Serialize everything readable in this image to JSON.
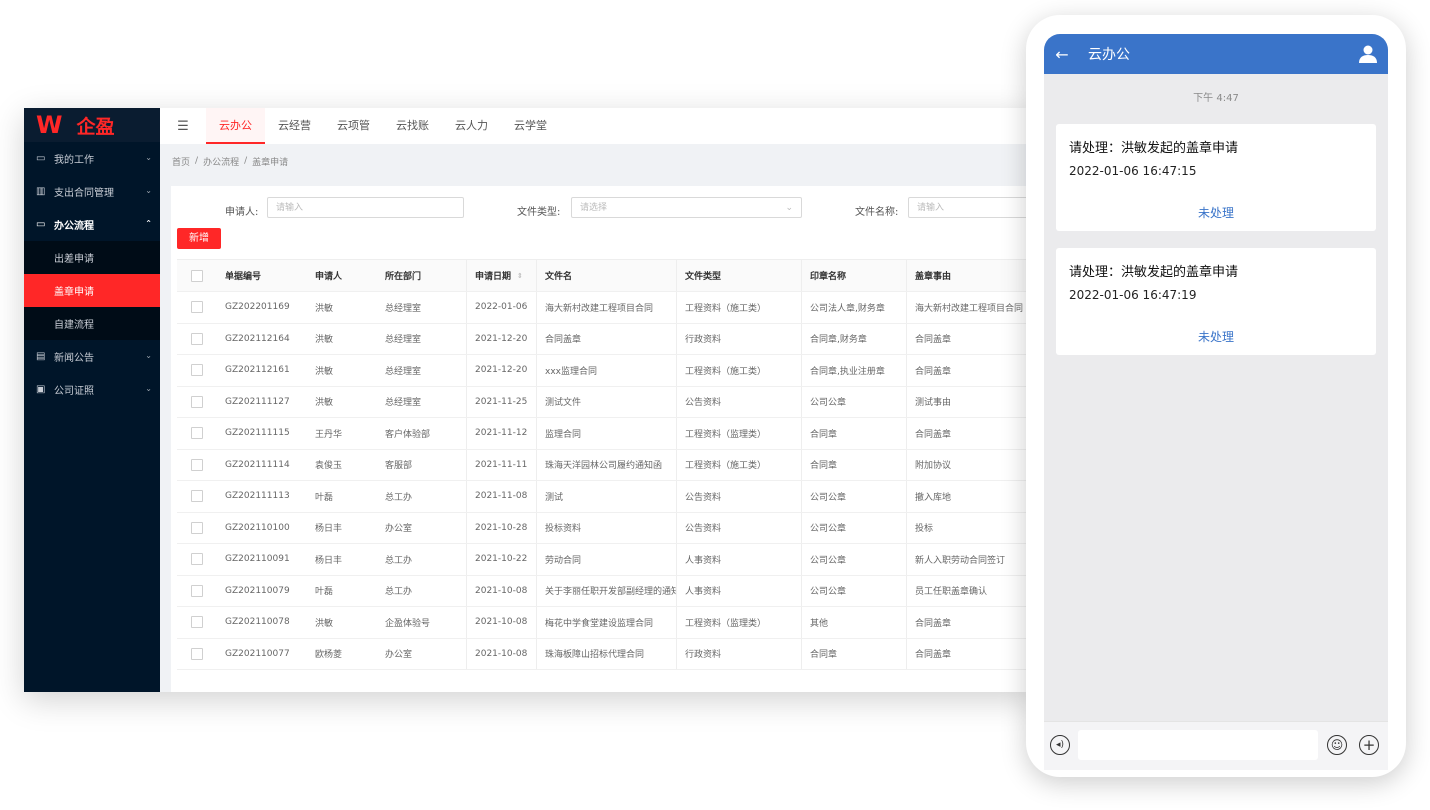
{
  "brand": {
    "mark": "W",
    "name": "企盈"
  },
  "sidebar": {
    "items": [
      {
        "label": "我的工作",
        "icon": "monitor-icon",
        "glyph": "▭"
      },
      {
        "label": "支出合同管理",
        "icon": "chart-icon",
        "glyph": "▥"
      },
      {
        "label": "办公流程",
        "icon": "monitor-icon",
        "glyph": "▭"
      },
      {
        "label": "新闻公告",
        "icon": "news-icon",
        "glyph": "▤"
      },
      {
        "label": "公司证照",
        "icon": "certificate-icon",
        "glyph": "▣"
      }
    ],
    "sub_items": [
      "出差申请",
      "盖章申请",
      "自建流程"
    ]
  },
  "tabs": [
    "云办公",
    "云经营",
    "云项管",
    "云找账",
    "云人力",
    "云学堂"
  ],
  "breadcrumb": [
    "首页",
    "办公流程",
    "盖章申请"
  ],
  "filters": {
    "applicant_label": "申请人:",
    "applicant_placeholder": "请输入",
    "filetype_label": "文件类型:",
    "filetype_placeholder": "请选择",
    "filename_label": "文件名称:",
    "filename_placeholder": "请输入"
  },
  "add_button": "新增",
  "table": {
    "columns": [
      "单据编号",
      "申请人",
      "所在部门",
      "申请日期",
      "文件名",
      "文件类型",
      "印章名称",
      "盖章事由"
    ],
    "rows": [
      [
        "GZ202201169",
        "洪敏",
        "总经理室",
        "2022-01-06",
        "海大新村改建工程项目合同",
        "工程资料（施工类）",
        "公司法人章,财务章",
        "海大新村改建工程项目合同"
      ],
      [
        "GZ202112164",
        "洪敏",
        "总经理室",
        "2021-12-20",
        "合同盖章",
        "行政资料",
        "合同章,财务章",
        "合同盖章"
      ],
      [
        "GZ202112161",
        "洪敏",
        "总经理室",
        "2021-12-20",
        "xxx监理合同",
        "工程资料（施工类）",
        "合同章,执业注册章",
        "合同盖章"
      ],
      [
        "GZ202111127",
        "洪敏",
        "总经理室",
        "2021-11-25",
        "测试文件",
        "公告资料",
        "公司公章",
        "测试事由"
      ],
      [
        "GZ202111115",
        "王丹华",
        "客户体验部",
        "2021-11-12",
        "监理合同",
        "工程资料（监理类）",
        "合同章",
        "合同盖章"
      ],
      [
        "GZ202111114",
        "袁俊玉",
        "客服部",
        "2021-11-11",
        "珠海天洋园林公司履约通知函",
        "工程资料（施工类）",
        "合同章",
        "附加协议"
      ],
      [
        "GZ202111113",
        "叶磊",
        "总工办",
        "2021-11-08",
        "测试",
        "公告资料",
        "公司公章",
        "撤入库地"
      ],
      [
        "GZ202110100",
        "杨日丰",
        "办公室",
        "2021-10-28",
        "投标资料",
        "公告资料",
        "公司公章",
        "投标"
      ],
      [
        "GZ202110091",
        "杨日丰",
        "总工办",
        "2021-10-22",
        "劳动合同",
        "人事资料",
        "公司公章",
        "新人入职劳动合同签订"
      ],
      [
        "GZ202110079",
        "叶磊",
        "总工办",
        "2021-10-08",
        "关于李丽任职开发部副经理的通知",
        "人事资料",
        "公司公章",
        "员工任职盖章确认"
      ],
      [
        "GZ202110078",
        "洪敏",
        "企盈体验号",
        "2021-10-08",
        "梅花中学食堂建设监理合同",
        "工程资料（监理类）",
        "其他",
        "合同盖章"
      ],
      [
        "GZ202110077",
        "欧杨菱",
        "办公室",
        "2021-10-08",
        "珠海板障山招标代理合同",
        "行政资料",
        "合同章",
        "合同盖章"
      ]
    ]
  },
  "phone": {
    "title": "云办公",
    "time": "下午 4:47",
    "cards": [
      {
        "title": "请处理：洪敏发起的盖章申请",
        "date": "2022-01-06 16:47:15",
        "status": "未处理"
      },
      {
        "title": "请处理：洪敏发起的盖章申请",
        "date": "2022-01-06 16:47:19",
        "status": "未处理"
      }
    ]
  },
  "colors": {
    "brand_red": "#ff2727",
    "sidebar_bg": "#001529",
    "phone_header": "#3a74c9"
  }
}
